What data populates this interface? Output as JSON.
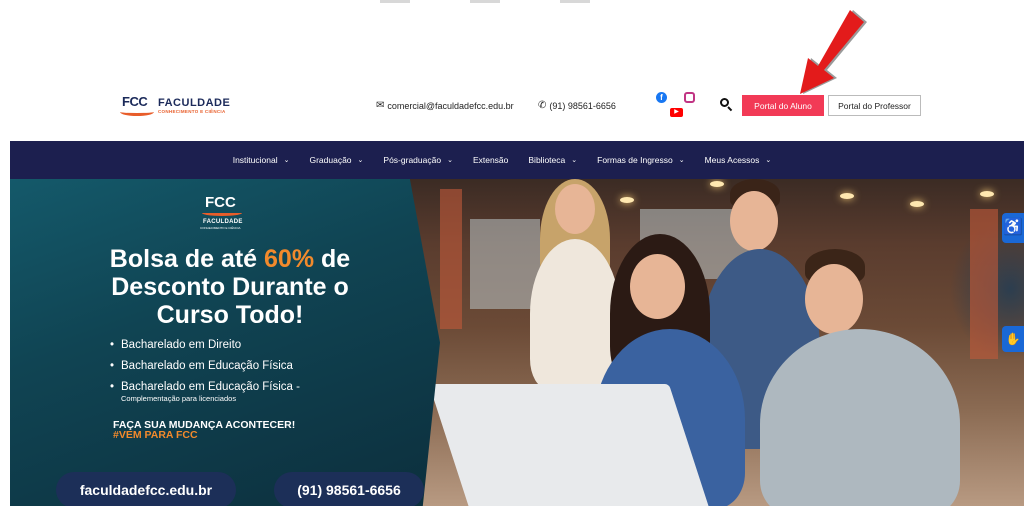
{
  "header": {
    "logo_mark": "FCC",
    "logo_title": "FACULDADE",
    "logo_subtitle": "CONHECIMENTO E CIÊNCIA",
    "email": "comercial@faculdadefcc.edu.br",
    "phone": "(91) 98561-6656",
    "portal_aluno": "Portal do Aluno",
    "portal_professor": "Portal do Professor"
  },
  "nav": {
    "items": [
      {
        "label": "Institucional",
        "dropdown": true
      },
      {
        "label": "Graduação",
        "dropdown": true
      },
      {
        "label": "Pós-graduação",
        "dropdown": true
      },
      {
        "label": "Extensão",
        "dropdown": false
      },
      {
        "label": "Biblioteca",
        "dropdown": true
      },
      {
        "label": "Formas de Ingresso",
        "dropdown": true
      },
      {
        "label": "Meus Acessos",
        "dropdown": true
      }
    ]
  },
  "hero": {
    "logo_mark": "FCC",
    "logo_title": "FACULDADE",
    "logo_subtitle": "CONHECIMENTO E CIÊNCIA",
    "headline_part1": "Bolsa de até ",
    "headline_highlight": "60%",
    "headline_part2": " de Desconto Durante o Curso Todo!",
    "bullets": [
      {
        "text": "Bacharelado em Direito",
        "note": ""
      },
      {
        "text": "Bacharelado em Educação Física",
        "note": ""
      },
      {
        "text": "Bacharelado em Educação Física -",
        "note": "Complementação para licenciados"
      }
    ],
    "cta_line1": "FAÇA SUA MUDANÇA ACONTECER!",
    "cta_line2": "#VEM PARA FCC",
    "site": "faculdadefcc.edu.br",
    "tel": "(91) 98561-6656"
  },
  "colors": {
    "accent": "#f23a56",
    "nav_bg": "#1c1f4f",
    "highlight": "#f28a2c",
    "accessibility": "#1a68d6",
    "arrow": "#e31b1b"
  },
  "icons": {
    "email": "mail-icon",
    "phone": "whatsapp-icon",
    "facebook": "facebook-icon",
    "instagram": "instagram-icon",
    "youtube": "youtube-icon",
    "search": "search-icon",
    "accessibility": "wheelchair-icon",
    "sign_language": "sign-language-icon"
  }
}
